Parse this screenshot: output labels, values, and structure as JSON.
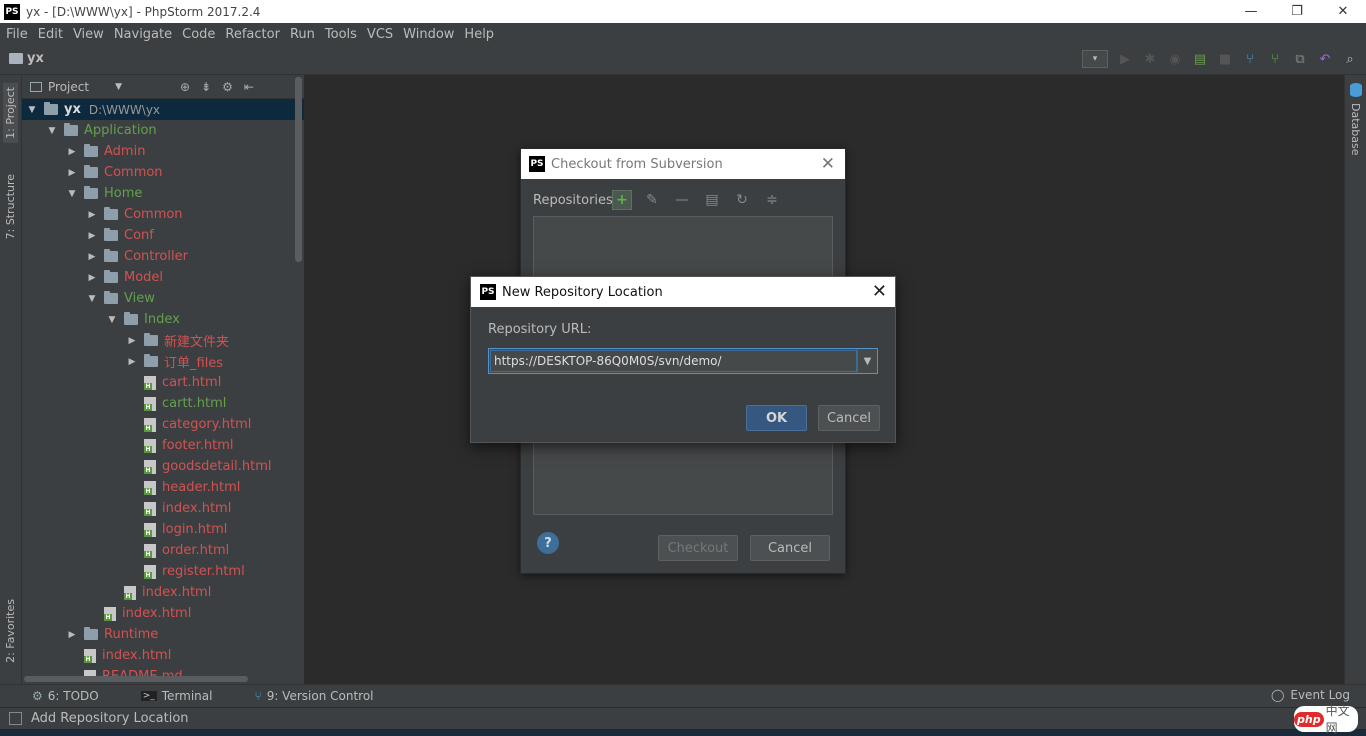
{
  "window": {
    "title": "yx - [D:\\WWW\\yx] - PhpStorm 2017.2.4",
    "logo": "PS",
    "controls": [
      "—",
      "❐",
      "✕"
    ]
  },
  "menu": [
    "File",
    "Edit",
    "View",
    "Navigate",
    "Code",
    "Refactor",
    "Run",
    "Tools",
    "VCS",
    "Window",
    "Help"
  ],
  "navbar": {
    "crumb": "yx"
  },
  "toolstrips": {
    "left": [
      "1: Project",
      "7: Structure",
      "2: Favorites"
    ],
    "right": [
      "Database"
    ]
  },
  "project_panel": {
    "header": "Project",
    "tree": [
      {
        "label": "yx",
        "extra": "D:\\WWW\\yx",
        "type": "folder",
        "depth": 0,
        "expanded": true,
        "style": "root",
        "selected": true
      },
      {
        "label": "Application",
        "type": "folder",
        "depth": 1,
        "expanded": true,
        "style": "green"
      },
      {
        "label": "Admin",
        "type": "folder",
        "depth": 2,
        "expanded": false,
        "style": "red"
      },
      {
        "label": "Common",
        "type": "folder",
        "depth": 2,
        "expanded": false,
        "style": "red"
      },
      {
        "label": "Home",
        "type": "folder",
        "depth": 2,
        "expanded": true,
        "style": "green"
      },
      {
        "label": "Common",
        "type": "folder",
        "depth": 3,
        "expanded": false,
        "style": "red"
      },
      {
        "label": "Conf",
        "type": "folder",
        "depth": 3,
        "expanded": false,
        "style": "red"
      },
      {
        "label": "Controller",
        "type": "folder",
        "depth": 3,
        "expanded": false,
        "style": "red"
      },
      {
        "label": "Model",
        "type": "folder",
        "depth": 3,
        "expanded": false,
        "style": "red"
      },
      {
        "label": "View",
        "type": "folder",
        "depth": 3,
        "expanded": true,
        "style": "green"
      },
      {
        "label": "Index",
        "type": "folder",
        "depth": 4,
        "expanded": true,
        "style": "green"
      },
      {
        "label": "新建文件夹",
        "type": "folder",
        "depth": 5,
        "expanded": false,
        "style": "red"
      },
      {
        "label": "订单_files",
        "type": "folder",
        "depth": 5,
        "expanded": false,
        "style": "red"
      },
      {
        "label": "cart.html",
        "type": "file",
        "depth": 5,
        "style": "red"
      },
      {
        "label": "cartt.html",
        "type": "file",
        "depth": 5,
        "style": "green"
      },
      {
        "label": "category.html",
        "type": "file",
        "depth": 5,
        "style": "red"
      },
      {
        "label": "footer.html",
        "type": "file",
        "depth": 5,
        "style": "red"
      },
      {
        "label": "goodsdetail.html",
        "type": "file",
        "depth": 5,
        "style": "red"
      },
      {
        "label": "header.html",
        "type": "file",
        "depth": 5,
        "style": "red"
      },
      {
        "label": "index.html",
        "type": "file",
        "depth": 5,
        "style": "red"
      },
      {
        "label": "login.html",
        "type": "file",
        "depth": 5,
        "style": "red"
      },
      {
        "label": "order.html",
        "type": "file",
        "depth": 5,
        "style": "red"
      },
      {
        "label": "register.html",
        "type": "file",
        "depth": 5,
        "style": "red"
      },
      {
        "label": "index.html",
        "type": "file",
        "depth": 4,
        "style": "red"
      },
      {
        "label": "index.html",
        "type": "file",
        "depth": 3,
        "style": "red"
      },
      {
        "label": "Runtime",
        "type": "folder",
        "depth": 2,
        "expanded": false,
        "style": "red"
      },
      {
        "label": "index.html",
        "type": "file",
        "depth": 2,
        "style": "red"
      },
      {
        "label": "README.md",
        "type": "file",
        "depth": 2,
        "style": "red"
      }
    ]
  },
  "checkout_dialog": {
    "title": "Checkout from Subversion",
    "repositories_label": "Repositories:",
    "help": "?",
    "checkout_button": "Checkout",
    "cancel_button": "Cancel"
  },
  "new_repo_dialog": {
    "title": "New Repository Location",
    "url_label": "Repository URL:",
    "url_value": "https://DESKTOP-86Q0M0S/svn/demo/",
    "ok_button": "OK",
    "cancel_button": "Cancel"
  },
  "bottom_tools": [
    {
      "label": "6: TODO",
      "icon": "todo-icon"
    },
    {
      "label": "Terminal",
      "icon": "terminal-icon"
    },
    {
      "label": "9: Version Control",
      "icon": "vcs-icon"
    }
  ],
  "event_log": "Event Log",
  "status": {
    "message": "Add Repository Location"
  },
  "watermark": {
    "badge": "php",
    "text": "中文网"
  },
  "colors": {
    "background": "#2b2b2b",
    "panel": "#3c3f41",
    "vcs_modified_red": "#d25252",
    "vcs_added_green": "#62a04e",
    "accent_blue": "#365880"
  }
}
